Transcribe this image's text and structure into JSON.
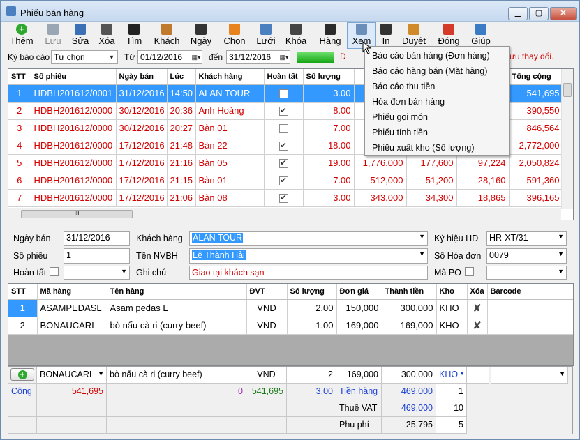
{
  "window": {
    "title": "Phiếu bán hàng"
  },
  "toolbar": [
    {
      "label": "Thêm",
      "icon": "add-icon",
      "color": "#2ea82e"
    },
    {
      "label": "Lưu",
      "icon": "save-icon",
      "color": "#9aa6b3"
    },
    {
      "label": "Sửa",
      "icon": "edit-icon",
      "color": "#3b6fb6"
    },
    {
      "label": "Xóa",
      "icon": "delete-icon",
      "color": "#555555"
    },
    {
      "label": "Tìm",
      "icon": "find-icon",
      "color": "#222222"
    },
    {
      "label": "Khách",
      "icon": "customer-icon",
      "color": "#c07a2e"
    },
    {
      "label": "Ngày",
      "icon": "date-icon",
      "color": "#333333"
    },
    {
      "label": "Chọn",
      "icon": "select-icon",
      "color": "#e8821e"
    },
    {
      "label": "Lưới",
      "icon": "grid-icon",
      "color": "#4a7fc0"
    },
    {
      "label": "Khóa",
      "icon": "lock-icon",
      "color": "#444444"
    },
    {
      "label": "Hàng",
      "icon": "goods-icon",
      "color": "#2b2b2b"
    },
    {
      "label": "Xem",
      "icon": "view-icon",
      "color": "#6a8fb8"
    },
    {
      "label": "In",
      "icon": "print-icon",
      "color": "#333333"
    },
    {
      "label": "Duyệt",
      "icon": "approve-icon",
      "color": "#d08a2a"
    },
    {
      "label": "Đóng",
      "icon": "power-icon",
      "color": "#d33a2a"
    },
    {
      "label": "Giúp",
      "icon": "help-icon",
      "color": "#3a7cc4"
    }
  ],
  "filter": {
    "period_label": "Kỳ báo cáo",
    "period_value": "Tự chọn",
    "from_label": "Từ",
    "from_value": "01/12/2016",
    "to_label": "đến",
    "to_value": "31/12/2016",
    "notice_left": "Đ",
    "notice_right": "ưu thay đổi."
  },
  "view_menu": {
    "items": [
      "Báo cáo bán hàng (Đơn hàng)",
      "Báo cáo hàng bán (Mặt hàng)",
      "Báo cáo thu tiền",
      "Hóa đơn bán hàng",
      "Phiếu gọi món",
      "Phiếu tính tiền",
      "Phiếu xuất kho (Số lượng)"
    ]
  },
  "orders": {
    "columns": [
      "STT",
      "Số phiếu",
      "Ngày bán",
      "Lúc",
      "Khách hàng",
      "Hoàn tất",
      "Số lượng",
      "",
      "",
      "",
      "Tổng cộng"
    ],
    "rows": [
      {
        "stt": "1",
        "so_phieu": "HDBH201612/0001",
        "ngay": "31/12/2016",
        "luc": "14:50",
        "khach": "ALAN TOUR",
        "hoan_tat": false,
        "sl": "3.00",
        "c1": "",
        "c2": "",
        "c3": "",
        "tong": "541,695",
        "selected": true
      },
      {
        "stt": "2",
        "so_phieu": "HDBH201612/0000",
        "ngay": "30/12/2016",
        "luc": "20:36",
        "khach": "Anh Hoàng",
        "hoan_tat": true,
        "sl": "8.00",
        "c1": "",
        "c2": "",
        "c3": "",
        "tong": "390,550",
        "selected": false
      },
      {
        "stt": "3",
        "so_phieu": "HDBH201612/0000",
        "ngay": "30/12/2016",
        "luc": "20:27",
        "khach": "Bàn 01",
        "hoan_tat": false,
        "sl": "7.00",
        "c1": "",
        "c2": "",
        "c3": "",
        "tong": "846,564",
        "selected": false
      },
      {
        "stt": "4",
        "so_phieu": "HDBH201612/0000",
        "ngay": "17/12/2016",
        "luc": "21:48",
        "khach": "Bàn 22",
        "hoan_tat": true,
        "sl": "18.00",
        "c1": "",
        "c2": "",
        "c3": "",
        "tong": "2,772,000",
        "selected": false
      },
      {
        "stt": "5",
        "so_phieu": "HDBH201612/0000",
        "ngay": "17/12/2016",
        "luc": "21:16",
        "khach": "Bàn 05",
        "hoan_tat": true,
        "sl": "19.00",
        "c1": "1,776,000",
        "c2": "177,600",
        "c3": "97,224",
        "tong": "2,050,824",
        "selected": false
      },
      {
        "stt": "6",
        "so_phieu": "HDBH201612/0000",
        "ngay": "17/12/2016",
        "luc": "21:15",
        "khach": "Bàn 01",
        "hoan_tat": true,
        "sl": "7.00",
        "c1": "512,000",
        "c2": "51,200",
        "c3": "28,160",
        "tong": "591,360",
        "selected": false
      },
      {
        "stt": "7",
        "so_phieu": "HDBH201612/0000",
        "ngay": "17/12/2016",
        "luc": "21:06",
        "khach": "Bàn 08",
        "hoan_tat": true,
        "sl": "3.00",
        "c1": "343,000",
        "c2": "34,300",
        "c3": "18,865",
        "tong": "396,165",
        "selected": false
      }
    ],
    "hscroll_grip": "III"
  },
  "form": {
    "ngay_ban_label": "Ngày bán",
    "ngay_ban": "31/12/2016",
    "khach_hang_label": "Khách hàng",
    "khach_hang": "ALAN TOUR",
    "ky_hieu_label": "Ký hiệu HĐ",
    "ky_hieu": "HR-XT/31",
    "so_phieu_label": "Số phiếu",
    "so_phieu": "1",
    "ten_nvbh_label": "Tên NVBH",
    "ten_nvbh": "Lê Thành Hải",
    "so_hoa_don_label": "Số Hóa đơn",
    "so_hoa_don": "0079",
    "hoan_tat_label": "Hoàn tất",
    "ghi_chu_label": "Ghi chú",
    "ghi_chu": "Giao tại khách sạn",
    "ma_po_label": "Mã PO"
  },
  "details": {
    "columns": [
      "STT",
      "Mã hàng",
      "Tên hàng",
      "ĐVT",
      "Số lượng",
      "Đơn giá",
      "Thành tiền",
      "Kho",
      "Xóa",
      "Barcode"
    ],
    "rows": [
      {
        "stt": "1",
        "ma": "ASAMPEDASL",
        "ten": "Asam pedas L",
        "dvt": "VND",
        "sl": "2.00",
        "don_gia": "150,000",
        "thanh_tien": "300,000",
        "kho": "KHO",
        "selected": true
      },
      {
        "stt": "2",
        "ma": "BONAUCARI",
        "ten": "bò nấu cà ri (curry beef)",
        "dvt": "VND",
        "sl": "1.00",
        "don_gia": "169,000",
        "thanh_tien": "169,000",
        "kho": "KHO",
        "selected": false
      }
    ]
  },
  "entry_row": {
    "ma": "BONAUCARI",
    "ten": "bò nấu cà ri (curry beef)",
    "dvt": "VND",
    "sl": "2",
    "don_gia": "169,000",
    "thanh_tien": "300,000",
    "kho": "KHO"
  },
  "totals": {
    "cong_label": "Cộng",
    "cong_value": "541,695",
    "zero_value": "0",
    "total2": "541,695",
    "qty": "3.00",
    "tien_hang_label": "Tiền hàng",
    "tien_hang": "469,000",
    "tien_hang_n": "1",
    "vat_label": "Thuế VAT",
    "vat": "469,000",
    "vat_n": "10",
    "phu_phi_label": "Phụ phí",
    "phu_phi": "25,795",
    "phu_phi_n": "5"
  }
}
